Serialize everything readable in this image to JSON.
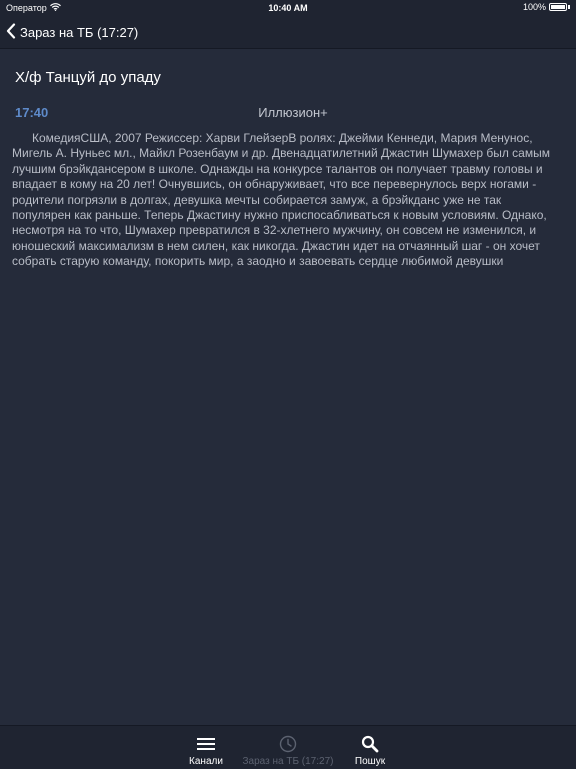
{
  "status_bar": {
    "carrier": "Оператор",
    "time": "10:40 AM",
    "battery_percent_label": "100%",
    "battery_level": 1.0
  },
  "nav": {
    "back_label": "Зараз на ТБ (17:27)"
  },
  "program": {
    "title": "Х/ф Танцуй до упаду",
    "time": "17:40",
    "channel": "Иллюзион+",
    "description": "КомедияСША, 2007 Режиссер: Харви ГлейзерВ ролях: Джейми Кеннеди, Мария Менунос, Мигель А. Нуньес мл., Майкл Розенбаум и др. Двенадцатилетний Джастин Шумахер был самым лучшим брэйкдансером в школе. Однажды на конкурсе талантов он получает травму головы и впадает в кому на 20 лет! Очнувшись, он обнаруживает, что все перевернулось верх ногами - родители погрязли в долгах, девушка мечты собирается замуж, а брэйкданс уже не так популярен как раньше. Теперь Джастину нужно приспосабливаться к новым условиям.  Однако, несмотря на то что, Шумахер превратился в 32-хлетнего мужчину, он совсем не изменился, и юношеский максимализм в нем силен, как никогда. Джастин идет на отчаянный шаг - он хочет собрать старую команду, покорить мир, а заодно и завоевать сердце любимой девушки"
  },
  "tabs": [
    {
      "label": "Канали",
      "icon": "list-icon",
      "active": true
    },
    {
      "label": "Зараз на ТБ (17:27)",
      "icon": "clock-icon",
      "active": false
    },
    {
      "label": "Пошук",
      "icon": "search-icon",
      "active": true
    }
  ],
  "colors": {
    "background": "#252b3a",
    "bar": "#1f2431",
    "accent_time": "#5e8ac9"
  }
}
